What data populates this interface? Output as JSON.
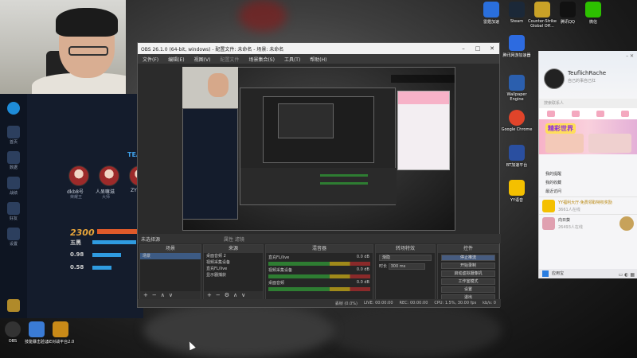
{
  "obs": {
    "title": "OBS 26.1.0 (64-bit, windows) - 配置文件: 未命名 - 场景: 未命名",
    "menu": [
      "文件(F)",
      "编辑(E)",
      "视图(V)",
      "配置文件",
      "场景集合(S)",
      "工具(T)",
      "帮助(H)"
    ],
    "source_bar": "未选择源",
    "source_bar_right": "属性   滤镜",
    "docks": {
      "scenes": {
        "title": "场景",
        "items": [
          "场景"
        ]
      },
      "sources": {
        "title": "来源",
        "items": [
          "桌面音频 2",
          "视频采集设备",
          "直充FL/live",
          "显示器捕获"
        ]
      },
      "mixer": {
        "title": "混音器",
        "channels": [
          {
            "label": "直充FL/live",
            "db": "0.0 dB"
          },
          {
            "label": "视频采集设备",
            "db": "0.0 dB"
          },
          {
            "label": "桌面音频",
            "db": "0.0 dB"
          }
        ]
      },
      "transitions": {
        "title": "转场特效",
        "type": "渐隐",
        "duration_label": "时长",
        "duration": "300 ms"
      },
      "controls": {
        "title": "控件",
        "buttons": [
          "停止推流",
          "开始录制",
          "启动虚拟摄像机",
          "工作室模式",
          "设置",
          "退出"
        ]
      }
    },
    "status": {
      "live": "LIVE: 00:00:00",
      "rec": "REC: 00:00:00",
      "cpu": "CPU: 1.5%, 30.00 fps",
      "dropped": "丢帧 (0.0%)",
      "kbps": "kb/s: 0"
    }
  },
  "game": {
    "sidebar": [
      "首页",
      "数据",
      "战绩",
      "好友",
      "设置"
    ],
    "team_label": "TEA",
    "players": [
      {
        "name": "dkb8号",
        "tag": "荣耀王"
      },
      {
        "name": "人呆嘛滋",
        "tag": "大师"
      },
      {
        "name": "ZY",
        "tag": ""
      }
    ],
    "score": "2300",
    "stats": [
      {
        "label": "五黑",
        "value": 0.92
      },
      {
        "label": "0.98",
        "value": 0.6
      },
      {
        "label": "0.58",
        "value": 0.4
      }
    ]
  },
  "desktop_icons": {
    "top_right": [
      {
        "label": "雷霆加速",
        "color": "#2a6fdc"
      },
      {
        "label": "Steam",
        "color": "#1b2838"
      },
      {
        "label": "Counter-Strike Global Off...",
        "color": "#c9a227"
      },
      {
        "label": "腾讯QQ",
        "color": "#111111"
      },
      {
        "label": "微信",
        "color": "#2dc100"
      }
    ],
    "right_column": [
      {
        "label": "腾讯网游加速器",
        "color": "#2d6be0"
      },
      {
        "label": "Wallpaper Engine",
        "color": "#2b5fae"
      },
      {
        "label": "Google Chrome",
        "color": "#e0442a"
      },
      {
        "label": "BT加速平台",
        "color": "#2a4fa0"
      },
      {
        "label": "YY语音",
        "color": "#f4c000"
      }
    ],
    "bottom_left": [
      {
        "label": "OBS",
        "color": "#333333"
      },
      {
        "label": "技能暴击验证",
        "color": "#3a7bd5"
      },
      {
        "label": "5E对战平台2.0",
        "color": "#c98a18"
      }
    ]
  },
  "qq": {
    "name": "TeuflichRache",
    "signature": "自己的事自己扛",
    "search_placeholder": "搜索联系人",
    "banner_title": "精彩世界",
    "menu": [
      "我的提醒",
      "我的收藏",
      "最近访问"
    ],
    "feed": [
      {
        "title": "YY福利大厅·免费领取特权奖励",
        "sub": "3661人在线"
      },
      {
        "title": "向日葵",
        "sub": "26493人在线"
      }
    ],
    "bottom": "应用宝"
  }
}
